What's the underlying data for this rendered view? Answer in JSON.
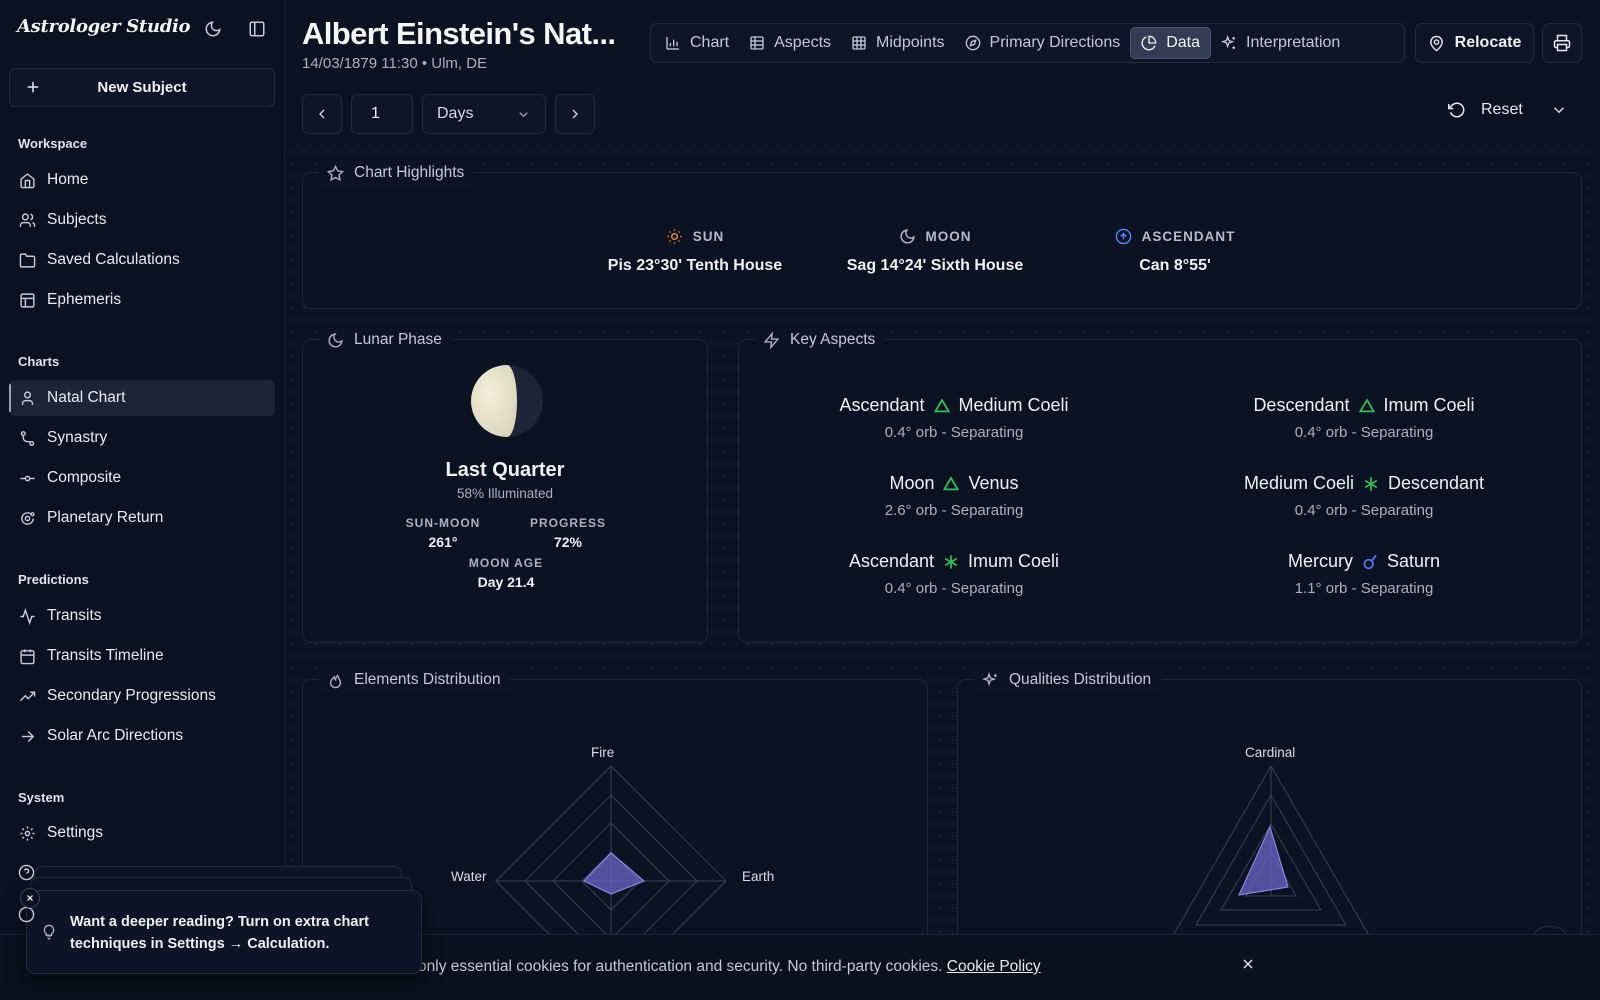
{
  "sidebar": {
    "brand": "Astrologer Studio",
    "new_subject": "New Subject",
    "workspace_title": "Workspace",
    "workspace": [
      {
        "label": "Home",
        "icon": "home-icon"
      },
      {
        "label": "Subjects",
        "icon": "users-icon"
      },
      {
        "label": "Saved Calculations",
        "icon": "folder-icon"
      },
      {
        "label": "Ephemeris",
        "icon": "table-icon"
      }
    ],
    "charts_title": "Charts",
    "charts": [
      {
        "label": "Natal Chart",
        "icon": "user-icon",
        "active": true
      },
      {
        "label": "Synastry",
        "icon": "git-icon"
      },
      {
        "label": "Composite",
        "icon": "commit-icon"
      },
      {
        "label": "Planetary Return",
        "icon": "orbit-icon"
      }
    ],
    "predictions_title": "Predictions",
    "predictions": [
      {
        "label": "Transits",
        "icon": "activity-icon"
      },
      {
        "label": "Transits Timeline",
        "icon": "calendar-icon"
      },
      {
        "label": "Secondary Progressions",
        "icon": "trending-icon"
      },
      {
        "label": "Solar Arc Directions",
        "icon": "arrow-right-icon"
      }
    ],
    "system_title": "System",
    "system": [
      {
        "label": "Settings",
        "icon": "gear-icon"
      }
    ]
  },
  "header": {
    "title": "Albert Einstein's Nat...",
    "subtitle": "14/03/1879 11:30 • Ulm, DE",
    "tabs": [
      {
        "label": "Chart",
        "icon": "bar-chart-icon"
      },
      {
        "label": "Aspects",
        "icon": "grid-icon"
      },
      {
        "label": "Midpoints",
        "icon": "grid-icon"
      },
      {
        "label": "Primary Directions",
        "icon": "compass-icon"
      },
      {
        "label": "Data",
        "icon": "pie-icon",
        "active": true
      },
      {
        "label": "Interpretation",
        "icon": "sparkles-icon"
      }
    ],
    "relocate": "Relocate",
    "step_value": "1",
    "step_unit": "Days",
    "reset": "Reset"
  },
  "highlights": {
    "title": "Chart Highlights",
    "sun": {
      "label": "SUN",
      "value": "Pis 23°30' Tenth House"
    },
    "moon": {
      "label": "MOON",
      "value": "Sag 14°24' Sixth House"
    },
    "ascendant": {
      "label": "ASCENDANT",
      "value": "Can 8°55'"
    }
  },
  "lunar": {
    "title": "Lunar Phase",
    "phase": "Last Quarter",
    "illuminated": "58% Illuminated",
    "sun_moon_label": "SUN-MOON",
    "sun_moon": "261°",
    "progress_label": "PROGRESS",
    "progress": "72%",
    "moon_age_label": "MOON AGE",
    "moon_age": "Day 21.4"
  },
  "aspects": {
    "title": "Key Aspects",
    "items": [
      {
        "a": "Ascendant",
        "b": "Medium Coeli",
        "symbol": "trine",
        "orb": "0.4° orb - Separating"
      },
      {
        "a": "Descendant",
        "b": "Imum Coeli",
        "symbol": "trine",
        "orb": "0.4° orb - Separating"
      },
      {
        "a": "Moon",
        "b": "Venus",
        "symbol": "trine",
        "orb": "2.6° orb - Separating"
      },
      {
        "a": "Medium Coeli",
        "b": "Descendant",
        "symbol": "sextile",
        "orb": "0.4° orb - Separating"
      },
      {
        "a": "Ascendant",
        "b": "Imum Coeli",
        "symbol": "sextile",
        "orb": "0.4° orb - Separating"
      },
      {
        "a": "Mercury",
        "b": "Saturn",
        "symbol": "conjunction",
        "orb": "1.1° orb - Separating"
      }
    ],
    "colors": {
      "trine": "#2fbf5b",
      "sextile": "#2fbf5b",
      "conjunction": "#4f7cff"
    }
  },
  "elements": {
    "title": "Elements Distribution",
    "labels": {
      "top": "Fire",
      "left": "Water",
      "right": "Earth"
    }
  },
  "qualities": {
    "title": "Qualities Distribution",
    "labels": {
      "top": "Cardinal"
    }
  },
  "toast": {
    "text": "Want a deeper reading? Turn on extra chart techniques in Settings → Calculation."
  },
  "cookie": {
    "text": "s only essential cookies for authentication and security. No third-party cookies.",
    "link": "Cookie Policy"
  }
}
